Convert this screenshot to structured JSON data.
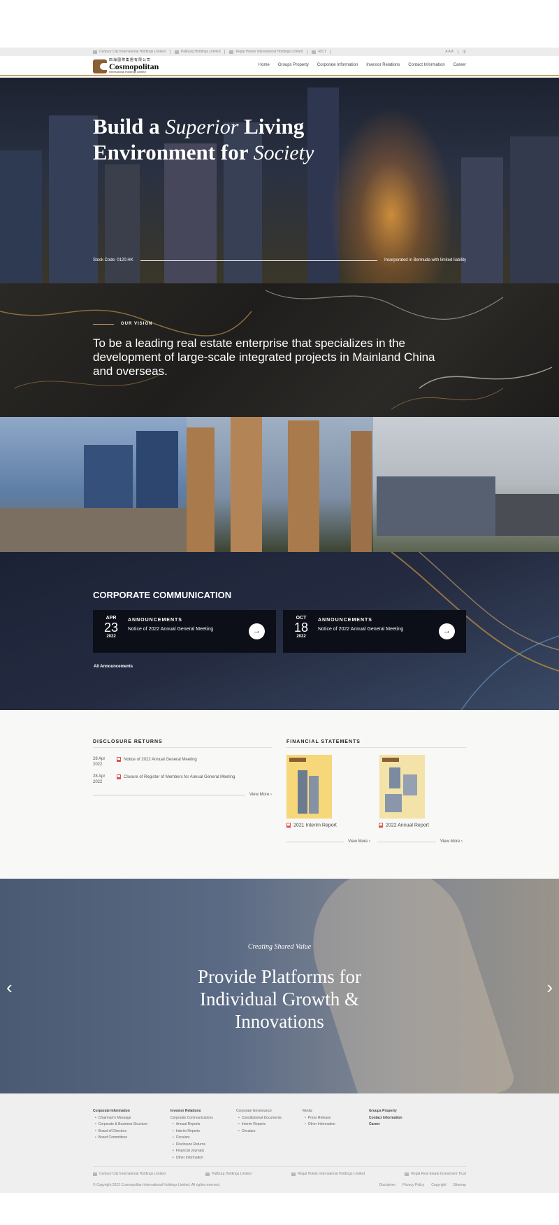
{
  "topbar": {
    "groups": [
      "Century City International Holdings Limited",
      "Paliburg Holdings Limited",
      "Regal Hotels International Holdings Limited",
      "RICT"
    ],
    "font_sizes": "A A A",
    "language": "中"
  },
  "header": {
    "logo_cn": "四海國際集團有限公司",
    "logo_en": "Cosmopolitan",
    "logo_sub": "International Holdings Limited",
    "nav": [
      "Home",
      "Groups Property",
      "Corporate Information",
      "Investor Relations",
      "Contact Information",
      "Career"
    ]
  },
  "hero": {
    "line1_a": "Build a ",
    "line1_script": "Superior",
    "line1_b": " Living",
    "line2_a": "Environment for ",
    "line2_script": "Society",
    "stock_code": "Stock Code: 0120.HK",
    "incorporated": "Incorporated in Bermuda with limited liability"
  },
  "vision": {
    "label": "OUR VISION",
    "text": "To be a leading real estate enterprise that specializes in the development of large-scale integrated projects in Mainland China and overseas."
  },
  "corporate": {
    "title": "CORPORATE COMMUNICATION",
    "cards": [
      {
        "month": "APR",
        "day": "23",
        "year": "2022",
        "type": "ANNOUNCEMENTS",
        "title": "Notice of 2022 Annual General Meeting"
      },
      {
        "month": "OCT",
        "day": "18",
        "year": "2022",
        "type": "ANNOUNCEMENTS",
        "title": "Notice of 2022 Annual General Meeting"
      }
    ],
    "all_link": "All Announcements"
  },
  "disclosure": {
    "title": "DISCLOSURE RETURNS",
    "items": [
      {
        "date": "28 Apr 2022",
        "title": "Notice of 2022 Annual General Meeting"
      },
      {
        "date": "28 Apr 2022",
        "title": "Closure of Register of Members for Annual General Meeting"
      }
    ],
    "view_more": "View More"
  },
  "financial": {
    "title": "FINANCIAL STATEMENTS",
    "reports": [
      {
        "title": "2021 Interim Report",
        "view_more": "View More"
      },
      {
        "title": "2022 Annual Report",
        "view_more": "View More"
      }
    ]
  },
  "carousel": {
    "kicker": "Creating Shared Value",
    "headline_1": "Provide Platforms for",
    "headline_2": "Individual Growth &",
    "headline_3": "Innovations",
    "prev": "‹",
    "next": "›"
  },
  "footer": {
    "col1": {
      "heading": "Corporate Information",
      "items": [
        "Chairman's Message",
        "Corporate & Business Structure",
        "Board of Directors",
        "Board Committees"
      ]
    },
    "col2": {
      "heading": "Investor Relations",
      "sub": "Corporate Communications",
      "items": [
        "Annual Reports",
        "Interim Reports",
        "Circulars",
        "Disclosure Returns",
        "Financial Journals",
        "Other Information"
      ]
    },
    "col3": {
      "heading": "Corporate Governance",
      "items": [
        "Constitutional Documents",
        "Interim Reports",
        "Circulars"
      ]
    },
    "col4": {
      "heading": "Media",
      "items": [
        "Press Release",
        "Other Information"
      ]
    },
    "col5": {
      "items": [
        "Groups Property",
        "Contact Information",
        "Career"
      ]
    },
    "groups": [
      "Century City International Holdings Limited",
      "Paliburg Holdings Limited",
      "Regal Hotels International Holdings Limited",
      "Regal Real Estate Investment Trust"
    ],
    "copyright": "© Copyright 2022 Cosmopolitan International Holdings Limited. All rights reserved.",
    "links": [
      "Disclaimer",
      "Privacy Policy",
      "Copyright",
      "Sitemap"
    ]
  }
}
